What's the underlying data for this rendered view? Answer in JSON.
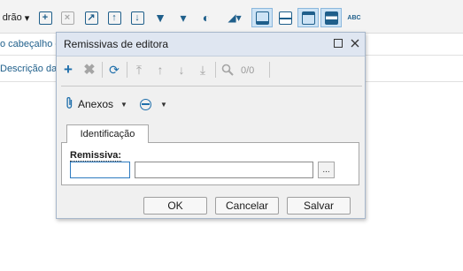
{
  "background": {
    "style_label": "drão",
    "link1": "o cabeçalho c",
    "link2": "Descrição da",
    "toolbar_icons": [
      "add-icon",
      "delete-icon",
      "link-icon",
      "move-up-icon",
      "move-down-icon",
      "paint-icon",
      "brush-icon",
      "fill-icon",
      "chart-icon",
      "layout-bottom-icon",
      "layout-split-icon",
      "layout-top-icon",
      "layout-both-icon",
      "abc-icon"
    ],
    "abc_text": "ABC"
  },
  "dialog": {
    "title": "Remissivas de editora",
    "counter": "0/0",
    "anexos_label": "Anexos",
    "tab_label": "Identificação",
    "field_label": "Remissiva:",
    "ellipsis": "...",
    "buttons": {
      "ok": "OK",
      "cancel": "Cancelar",
      "save": "Salvar"
    }
  }
}
